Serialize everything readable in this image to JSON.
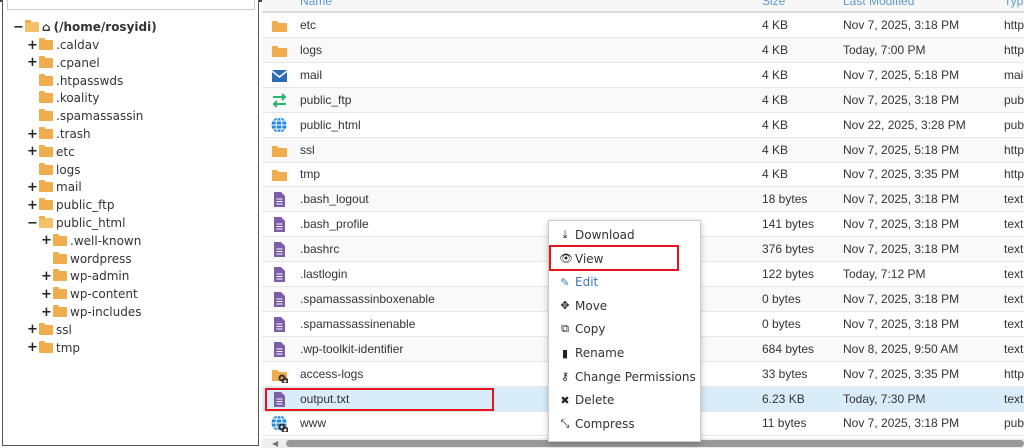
{
  "tree": {
    "root": "(/home/rosyidi)",
    "nodes": [
      {
        "label": ".caldav",
        "toggle": "+",
        "level": 1
      },
      {
        "label": ".cpanel",
        "toggle": "+",
        "level": 1
      },
      {
        "label": ".htpasswds",
        "toggle": "",
        "level": 1
      },
      {
        "label": ".koality",
        "toggle": "",
        "level": 1
      },
      {
        "label": ".spamassassin",
        "toggle": "",
        "level": 1
      },
      {
        "label": ".trash",
        "toggle": "+",
        "level": 1
      },
      {
        "label": "etc",
        "toggle": "+",
        "level": 1
      },
      {
        "label": "logs",
        "toggle": "",
        "level": 1
      },
      {
        "label": "mail",
        "toggle": "+",
        "level": 1
      },
      {
        "label": "public_ftp",
        "toggle": "+",
        "level": 1
      },
      {
        "label": "public_html",
        "toggle": "−",
        "level": 1,
        "open": true
      },
      {
        "label": ".well-known",
        "toggle": "+",
        "level": 2
      },
      {
        "label": "wordpress",
        "toggle": "",
        "level": 2
      },
      {
        "label": "wp-admin",
        "toggle": "+",
        "level": 2
      },
      {
        "label": "wp-content",
        "toggle": "+",
        "level": 2
      },
      {
        "label": "wp-includes",
        "toggle": "+",
        "level": 2
      },
      {
        "label": "ssl",
        "toggle": "+",
        "level": 1
      },
      {
        "label": "tmp",
        "toggle": "+",
        "level": 1
      }
    ]
  },
  "table": {
    "headers": {
      "name": "Name",
      "size": "Size",
      "modified": "Last Modified",
      "type": "Typ"
    },
    "rows": [
      {
        "name": "etc",
        "size": "4 KB",
        "modified": "Nov 7, 2025, 3:18 PM",
        "type": "http",
        "icon": "folder"
      },
      {
        "name": "logs",
        "size": "4 KB",
        "modified": "Today, 7:00 PM",
        "type": "http",
        "icon": "folder"
      },
      {
        "name": "mail",
        "size": "4 KB",
        "modified": "Nov 7, 2025, 5:18 PM",
        "type": "mai",
        "icon": "mail"
      },
      {
        "name": "public_ftp",
        "size": "4 KB",
        "modified": "Nov 7, 2025, 3:18 PM",
        "type": "pub",
        "icon": "ftp"
      },
      {
        "name": "public_html",
        "size": "4 KB",
        "modified": "Nov 22, 2025, 3:28 PM",
        "type": "pub",
        "icon": "globe"
      },
      {
        "name": "ssl",
        "size": "4 KB",
        "modified": "Nov 7, 2025, 5:18 PM",
        "type": "http",
        "icon": "folder"
      },
      {
        "name": "tmp",
        "size": "4 KB",
        "modified": "Nov 7, 2025, 3:35 PM",
        "type": "http",
        "icon": "folder"
      },
      {
        "name": ".bash_logout",
        "size": "18 bytes",
        "modified": "Nov 7, 2025, 3:18 PM",
        "type": "text",
        "icon": "file"
      },
      {
        "name": ".bash_profile",
        "size": "141 bytes",
        "modified": "Nov 7, 2025, 3:18 PM",
        "type": "text",
        "icon": "file"
      },
      {
        "name": ".bashrc",
        "size": "376 bytes",
        "modified": "Nov 7, 2025, 3:18 PM",
        "type": "text",
        "icon": "file"
      },
      {
        "name": ".lastlogin",
        "size": "122 bytes",
        "modified": "Today, 7:12 PM",
        "type": "text",
        "icon": "file"
      },
      {
        "name": ".spamassassinboxenable",
        "size": "0 bytes",
        "modified": "Nov 7, 2025, 3:18 PM",
        "type": "text",
        "icon": "file"
      },
      {
        "name": ".spamassassinenable",
        "size": "0 bytes",
        "modified": "Nov 7, 2025, 3:18 PM",
        "type": "text",
        "icon": "file"
      },
      {
        "name": ".wp-toolkit-identifier",
        "size": "684 bytes",
        "modified": "Nov 8, 2025, 9:50 AM",
        "type": "text",
        "icon": "file"
      },
      {
        "name": "access-logs",
        "size": "33 bytes",
        "modified": "Nov 7, 2025, 3:35 PM",
        "type": "http",
        "icon": "folder-link"
      },
      {
        "name": "output.txt",
        "size": "6.23 KB",
        "modified": "Today, 7:30 PM",
        "type": "text",
        "icon": "file",
        "selected": true
      },
      {
        "name": "www",
        "size": "11 bytes",
        "modified": "Nov 7, 2025, 3:18 PM",
        "type": "pub",
        "icon": "globe-link"
      }
    ]
  },
  "context_menu": {
    "items": [
      {
        "label": "Download",
        "icon": "download-icon",
        "glyph": "⤓"
      },
      {
        "label": "View",
        "icon": "eye-icon",
        "glyph": "👁",
        "highlighted": true
      },
      {
        "label": "Edit",
        "icon": "pencil-icon",
        "glyph": "✎"
      },
      {
        "label": "Move",
        "icon": "move-icon",
        "glyph": "✥"
      },
      {
        "label": "Copy",
        "icon": "copy-icon",
        "glyph": "⧉"
      },
      {
        "label": "Rename",
        "icon": "file-icon",
        "glyph": "▮"
      },
      {
        "label": "Change Permissions",
        "icon": "key-icon",
        "glyph": "⚷"
      },
      {
        "label": "Delete",
        "icon": "close-icon",
        "glyph": "✖"
      },
      {
        "label": "Compress",
        "icon": "compress-icon",
        "glyph": "⤡"
      }
    ]
  },
  "colors": {
    "folder": "#f0ad4e",
    "file": "#7b5ea7",
    "mail": "#2a6db5",
    "ftp": "#2bb673",
    "globe": "#1e88e5",
    "highlight": "#e8141c",
    "selected_row": "#d9ecf9",
    "link": "#5b9bd5"
  }
}
